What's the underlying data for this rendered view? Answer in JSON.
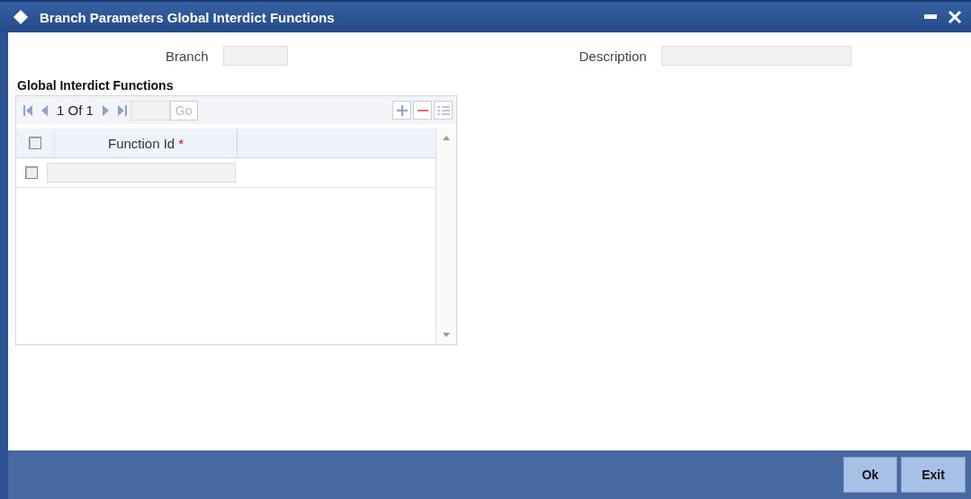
{
  "window": {
    "title": "Branch Parameters Global Interdict Functions"
  },
  "fields": [
    {
      "label": "Branch"
    },
    {
      "label": "Description"
    }
  ],
  "section": {
    "title": "Global Interdict Functions",
    "pager": {
      "text": "1 Of 1",
      "go": "Go"
    },
    "columns": [
      {
        "label": "Function Id",
        "required": "*"
      }
    ],
    "header_checked": false,
    "rows": [
      {
        "checked": false
      }
    ]
  },
  "buttons": [
    "Ok",
    "Exit"
  ]
}
